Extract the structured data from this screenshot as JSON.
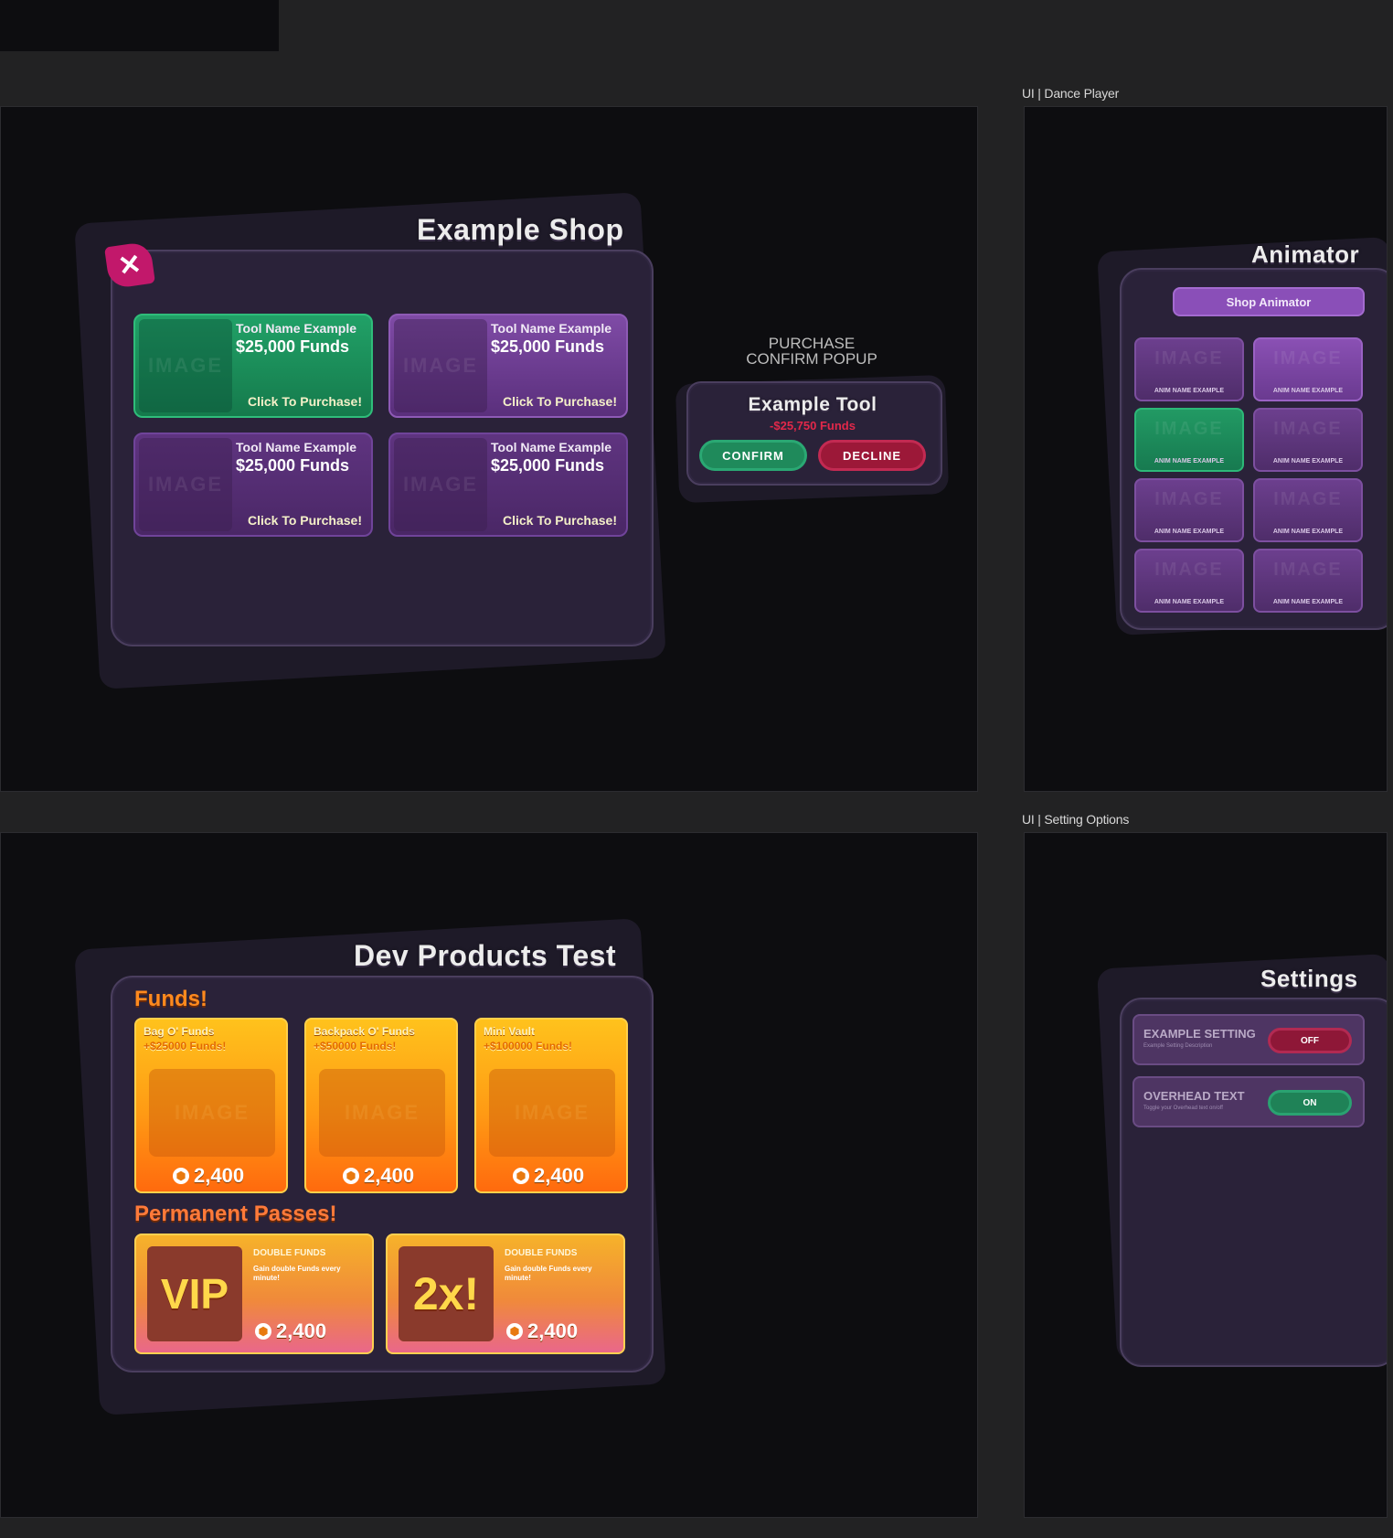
{
  "frames": {
    "dance_player_label": "UI | Dance Player",
    "setting_options_label": "UI | Setting Options"
  },
  "shop": {
    "title": "Example Shop",
    "close_label": "✕",
    "cards": [
      {
        "name": "Tool Name Example",
        "price": "$25,000 Funds",
        "cta": "Click To Purchase!",
        "image": "IMAGE",
        "color": "#21a167"
      },
      {
        "name": "Tool Name Example",
        "price": "$25,000 Funds",
        "cta": "Click To Purchase!",
        "image": "IMAGE",
        "color": "#7f4ba6"
      },
      {
        "name": "Tool Name Example",
        "price": "$25,000 Funds",
        "cta": "Click To Purchase!",
        "image": "IMAGE",
        "color": "#5a2f7c"
      },
      {
        "name": "Tool Name Example",
        "price": "$25,000 Funds",
        "cta": "Click To Purchase!",
        "image": "IMAGE",
        "color": "#5a2f7c"
      }
    ]
  },
  "popup": {
    "label_line1": "PURCHASE",
    "label_line2": "CONFIRM POPUP",
    "title": "Example Tool",
    "price": "-$25,750 Funds",
    "confirm": "CONFIRM",
    "decline": "DECLINE"
  },
  "animator": {
    "title": "Animator",
    "shop_button": "Shop Animator",
    "tiles": [
      {
        "image": "IMAGE",
        "name": "ANIM NAME EXAMPLE"
      },
      {
        "image": "IMAGE",
        "name": "ANIM NAME EXAMPLE"
      },
      {
        "image": "IMAGE",
        "name": "ANIM NAME EXAMPLE"
      },
      {
        "image": "IMAGE",
        "name": "ANIM NAME EXAMPLE"
      },
      {
        "image": "IMAGE",
        "name": "ANIM NAME EXAMPLE"
      },
      {
        "image": "IMAGE",
        "name": "ANIM NAME EXAMPLE"
      },
      {
        "image": "IMAGE",
        "name": "ANIM NAME EXAMPLE"
      },
      {
        "image": "IMAGE",
        "name": "ANIM NAME EXAMPLE"
      }
    ]
  },
  "dev_products": {
    "title": "Dev Products Test",
    "funds_heading": "Funds!",
    "passes_heading": "Permanent Passes!",
    "fund_cards": [
      {
        "title": "Bag O' Funds",
        "subtitle": "+$25000 Funds!",
        "image": "IMAGE",
        "price": "2,400"
      },
      {
        "title": "Backpack O' Funds",
        "subtitle": "+$50000 Funds!",
        "image": "IMAGE",
        "price": "2,400"
      },
      {
        "title": "Mini Vault",
        "subtitle": "+$100000 Funds!",
        "image": "IMAGE",
        "price": "2,400"
      }
    ],
    "pass_cards": [
      {
        "image_text": "VIP",
        "title": "DOUBLE FUNDS",
        "desc": "Gain double Funds every minute!",
        "price": "2,400"
      },
      {
        "image_text": "2x!",
        "title": "DOUBLE FUNDS",
        "desc": "Gain double Funds every minute!",
        "price": "2,400"
      }
    ]
  },
  "settings": {
    "title": "Settings",
    "rows": [
      {
        "name": "EXAMPLE SETTING",
        "desc": "Example Setting Description",
        "toggle": "OFF"
      },
      {
        "name": "OVERHEAD TEXT",
        "desc": "Toggle your Overhead text on/off",
        "toggle": "ON"
      }
    ]
  }
}
